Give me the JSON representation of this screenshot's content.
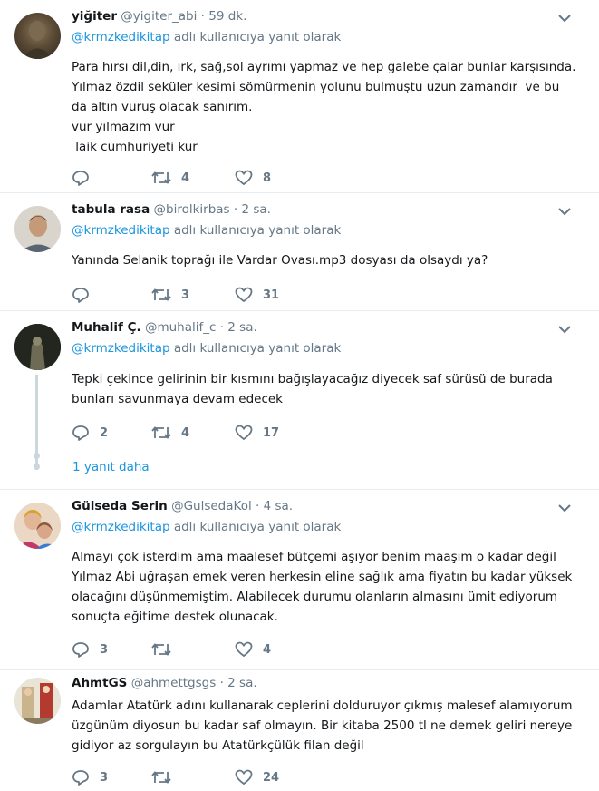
{
  "reply_prefix_suffix": "adlı kullanıcıya yanıt olarak",
  "tweets": [
    {
      "name": "yiğiter",
      "handle": "@yigiter_abi",
      "sep": "·",
      "time": "59 dk.",
      "reply_to": "@krmzkedikitap",
      "lines": [
        "Para hırsı dil,din, ırk, sağ,sol ayrımı yapmaz ve hep galebe çalar bunlar karşısında.",
        "Yılmaz özdil seküler kesimi sömürmenin yolunu bulmuştu uzun zamandır  ve bu",
        "da altın vuruş olacak sanırım.",
        "vur yılmazım vur",
        " laik cumhuriyeti kur"
      ],
      "replies": "",
      "retweets": "4",
      "likes": "8"
    },
    {
      "name": "tabula rasa",
      "handle": "@birolkirbas",
      "sep": "·",
      "time": "2 sa.",
      "reply_to": "@krmzkedikitap",
      "lines": [
        "Yanında Selanik toprağı ile Vardar Ovası.mp3 dosyası da olsaydı ya?"
      ],
      "replies": "",
      "retweets": "3",
      "likes": "31"
    },
    {
      "name": "Muhalif Ç.",
      "handle": "@muhalif_c",
      "sep": "·",
      "time": "2 sa.",
      "reply_to": "@krmzkedikitap",
      "lines": [
        "Tepki çekince gelirinin bir kısmını bağışlayacağız diyecek saf sürüsü de burada",
        "bunları savunmaya devam edecek"
      ],
      "replies": "2",
      "retweets": "4",
      "likes": "17",
      "more_replies": "1 yanıt daha"
    },
    {
      "name": "Gülseda Serin",
      "handle": "@GulsedaKol",
      "sep": "·",
      "time": "4 sa.",
      "reply_to": "@krmzkedikitap",
      "lines": [
        "Almayı çok isterdim ama maalesef bütçemi aşıyor benim maaşım o kadar değil",
        "Yılmaz Abi uğraşan emek veren herkesin eline sağlık ama fiyatın bu kadar yüksek",
        "olacağını düşünmemiştim. Alabilecek durumu olanların almasını ümit ediyorum",
        "sonuçta eğitime destek olunacak."
      ],
      "replies": "3",
      "retweets": "",
      "likes": "4"
    },
    {
      "name": "AhmtGS",
      "handle": "@ahmettgsgs",
      "sep": "·",
      "time": "2 sa.",
      "reply_to": "",
      "lines": [
        "Adamlar Atatürk adını kullanarak ceplerini dolduruyor çıkmış malesef alamıyorum",
        "üzgünüm diyosun bu kadar saf olmayın. Bir kitaba 2500 tl ne demek geliri nereye",
        "gidiyor az sorgulayın bu Atatürkçülük filan değil"
      ],
      "replies": "3",
      "retweets": "",
      "likes": "24"
    }
  ]
}
